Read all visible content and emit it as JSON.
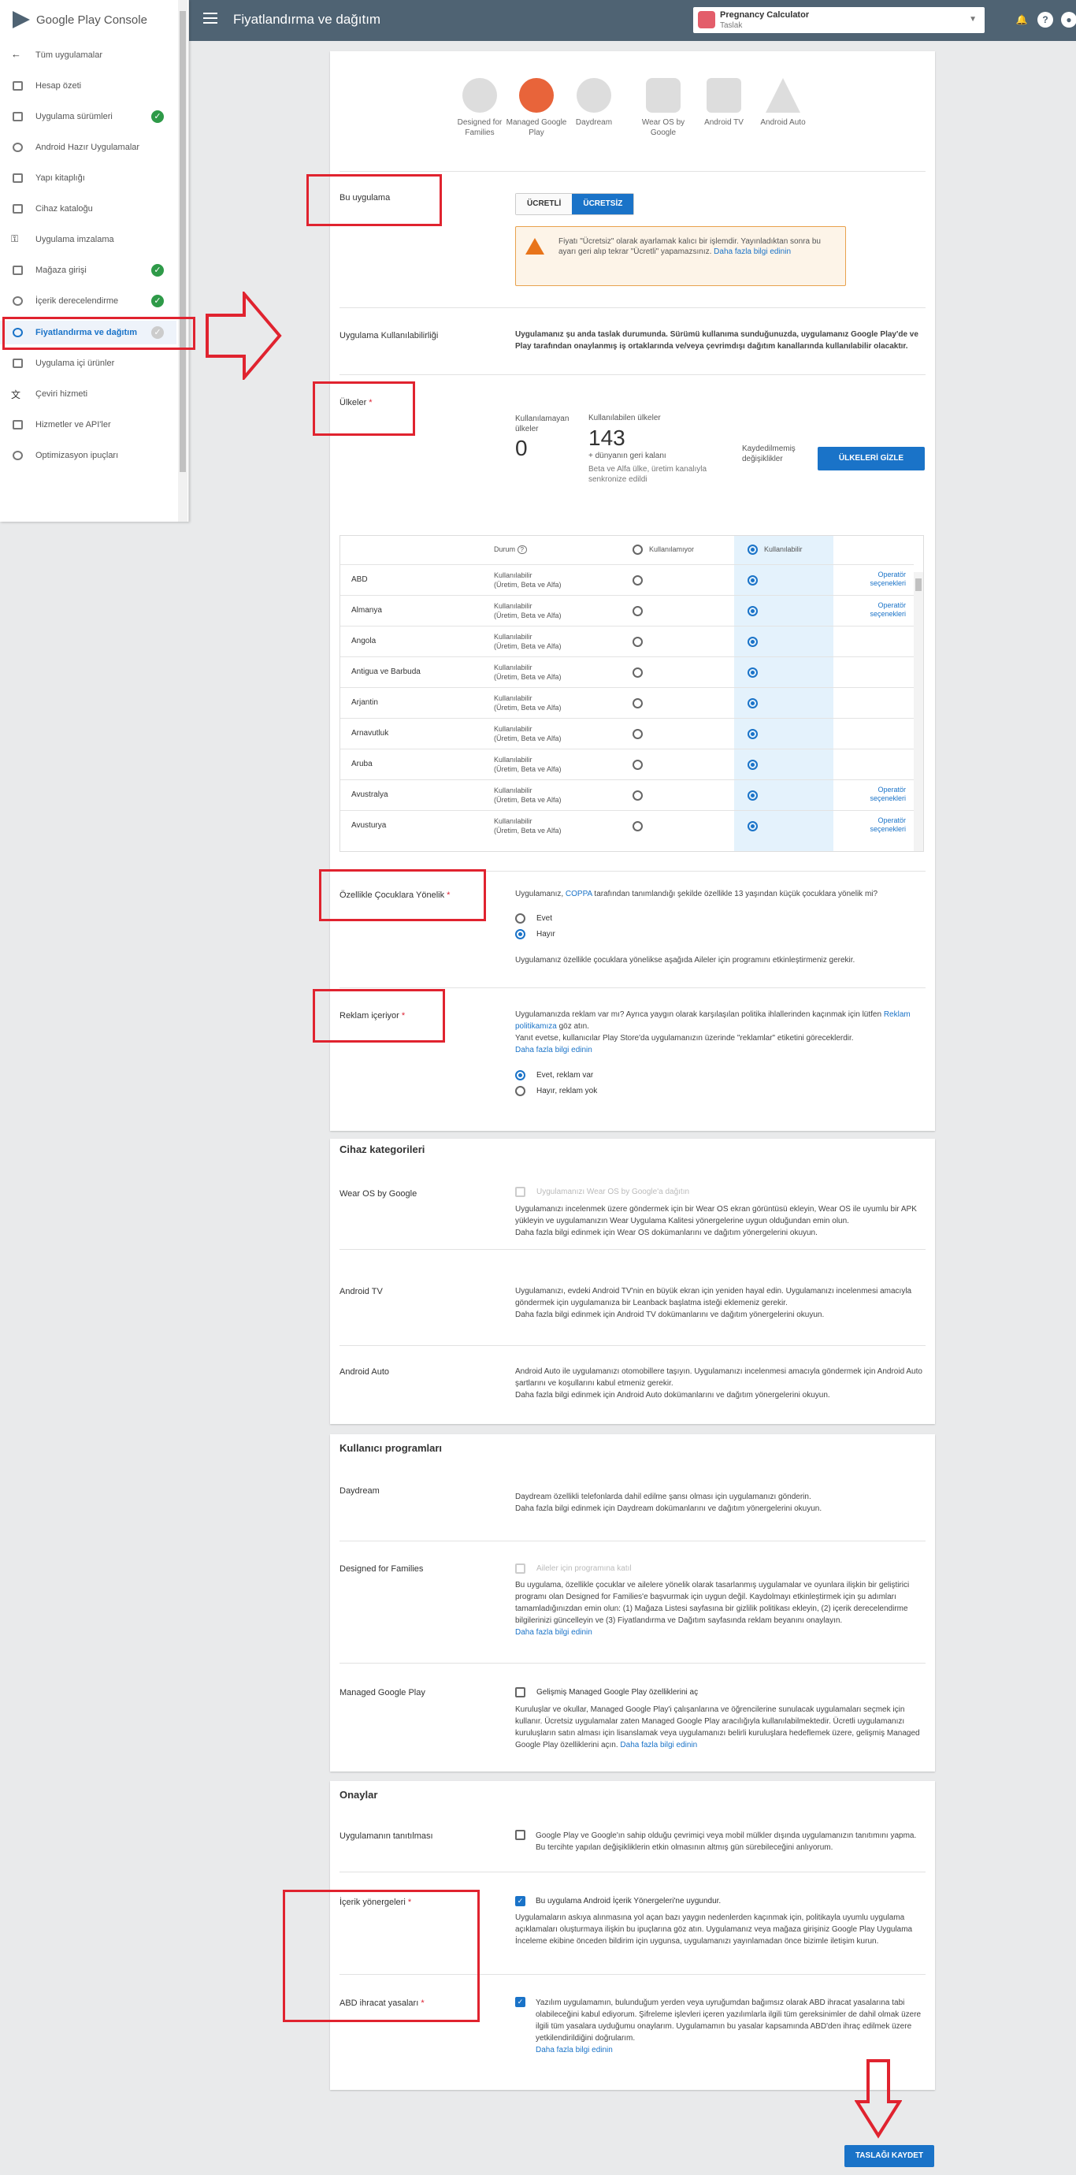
{
  "topbar": {
    "title": "Fiyatlandırma ve dağıtım",
    "app_name": "Pregnancy Calculator",
    "app_status": "Taslak"
  },
  "brand": {
    "logo_text": "Google Play Console"
  },
  "sidebar": {
    "items": [
      {
        "label": "Tüm uygulamalar",
        "check": ""
      },
      {
        "label": "Hesap özeti",
        "check": ""
      },
      {
        "label": "Uygulama sürümleri",
        "check": "✓"
      },
      {
        "label": "Android Hazır Uygulamalar",
        "check": ""
      },
      {
        "label": "Yapı kitaplığı",
        "check": ""
      },
      {
        "label": "Cihaz kataloğu",
        "check": ""
      },
      {
        "label": "Uygulama imzalama",
        "check": ""
      },
      {
        "label": "Mağaza girişi",
        "check": "✓"
      },
      {
        "label": "İçerik derecelendirme",
        "check": "✓"
      },
      {
        "label": "Fiyatlandırma ve dağıtım",
        "check": "✓"
      },
      {
        "label": "Uygulama içi ürünler",
        "check": ""
      },
      {
        "label": "Çeviri hizmeti",
        "check": ""
      },
      {
        "label": "Hizmetler ve API'ler",
        "check": ""
      },
      {
        "label": "Optimizasyon ipuçları",
        "check": ""
      }
    ]
  },
  "devices": [
    {
      "label": "Designed for Families"
    },
    {
      "label": "Managed Google Play"
    },
    {
      "label": "Daydream"
    },
    {
      "label": "Wear OS by Google"
    },
    {
      "label": "Android TV"
    },
    {
      "label": "Android Auto"
    }
  ],
  "pricing": {
    "label": "Bu uygulama",
    "paid": "ÜCRETLİ",
    "free": "ÜCRETSİZ",
    "warning": "Fiyatı \"Ücretsiz\" olarak ayarlamak kalıcı bir işlemdir. Yayınladıktan sonra bu ayarı geri alıp tekrar \"Ücretli\" yapamazsınız.",
    "warning_link": "Daha fazla bilgi edinin"
  },
  "availability": {
    "label": "Uygulama Kullanılabilirliği",
    "text": "Uygulamanız şu anda taslak durumunda. Sürümü kullanıma sunduğunuzda, uygulamanız Google Play'de ve Play tarafından onaylanmış iş ortaklarında ve/veya çevrimdışı dağıtım kanallarında kullanılabilir olacaktır."
  },
  "countries": {
    "label": "Ülkeler",
    "unavail_label": "Kullanılamayan ülkeler",
    "unavail_count": "0",
    "avail_label": "Kullanılabilen ülkeler",
    "avail_count": "143",
    "rest_world": "+ dünyanın geri kalanı",
    "beta_note": "Beta ve Alfa ülke, üretim kanalıyla senkronize edildi",
    "unsaved": "Kaydedilmemiş değişiklikler",
    "hide_btn": "ÜLKELERİ GİZLE",
    "col_status": "Durum",
    "col_unavail": "Kullanılamıyor",
    "col_avail": "Kullanılabilir",
    "rows": [
      {
        "name": "ABD",
        "status1": "Kullanılabilir",
        "status2": "(Üretim, Beta ve Alfa)",
        "opt1": "Operatör",
        "opt2": "seçenekleri"
      },
      {
        "name": "Almanya",
        "status1": "Kullanılabilir",
        "status2": "(Üretim, Beta ve Alfa)",
        "opt1": "Operatör",
        "opt2": "seçenekleri"
      },
      {
        "name": "Angola",
        "status1": "Kullanılabilir",
        "status2": "(Üretim, Beta ve Alfa)",
        "opt1": "",
        "opt2": ""
      },
      {
        "name": "Antigua ve Barbuda",
        "status1": "Kullanılabilir",
        "status2": "(Üretim, Beta ve Alfa)",
        "opt1": "",
        "opt2": ""
      },
      {
        "name": "Arjantin",
        "status1": "Kullanılabilir",
        "status2": "(Üretim, Beta ve Alfa)",
        "opt1": "",
        "opt2": ""
      },
      {
        "name": "Arnavutluk",
        "status1": "Kullanılabilir",
        "status2": "(Üretim, Beta ve Alfa)",
        "opt1": "",
        "opt2": ""
      },
      {
        "name": "Aruba",
        "status1": "Kullanılabilir",
        "status2": "(Üretim, Beta ve Alfa)",
        "opt1": "",
        "opt2": ""
      },
      {
        "name": "Avustralya",
        "status1": "Kullanılabilir",
        "status2": "(Üretim, Beta ve Alfa)",
        "opt1": "Operatör",
        "opt2": "seçenekleri"
      },
      {
        "name": "Avusturya",
        "status1": "Kullanılabilir",
        "status2": "(Üretim, Beta ve Alfa)",
        "opt1": "Operatör",
        "opt2": "seçenekleri"
      }
    ]
  },
  "children": {
    "label": "Özellikle Çocuklara Yönelik",
    "q_pre": "Uygulamanız,",
    "q_link": "COPPA",
    "q_post": "tarafından tanımlandığı şekilde özellikle 13 yaşından küçük çocuklara yönelik mi?",
    "yes": "Evet",
    "no": "Hayır",
    "note": "Uygulamanız özellikle çocuklara yönelikse aşağıda Aileler için programını etkinleştirmeniz gerekir."
  },
  "ads": {
    "label": "Reklam içeriyor",
    "text1": "Uygulamanızda reklam var mı? Ayrıca yaygın olarak karşılaşılan politika ihlallerinden kaçınmak için lütfen",
    "link1": "Reklam politikamıza",
    "text1b": "göz atın.",
    "text2": "Yanıt evetse, kullanıcılar Play Store'da uygulamanızın üzerinde \"reklamlar\" etiketini göreceklerdir.",
    "link2": "Daha fazla bilgi edinin",
    "yes": "Evet, reklam var",
    "no": "Hayır, reklam yok"
  },
  "device_cats": {
    "title": "Cihaz kategorileri",
    "wear_label": "Wear OS by Google",
    "wear_cb": "Uygulamanızı Wear OS by Google'a dağıtın",
    "wear_text": "Uygulamanızı incelenmek üzere göndermek için bir Wear OS ekran görüntüsü ekleyin, Wear OS ile uyumlu bir APK yükleyin ve uygulamanızın Wear Uygulama Kalitesi yönergelerine uygun olduğundan emin olun.",
    "wear_text2": "Daha fazla bilgi edinmek için Wear OS dokümanlarını ve dağıtım yönergelerini okuyun.",
    "tv_label": "Android TV",
    "tv_text": "Uygulamanızı, evdeki Android TV'nin en büyük ekran için yeniden hayal edin. Uygulamanızı incelenmesi amacıyla göndermek için uygulamanıza bir Leanback başlatma isteği eklemeniz gerekir.",
    "tv_text2": "Daha fazla bilgi edinmek için Android TV dokümanlarını ve dağıtım yönergelerini okuyun.",
    "auto_label": "Android Auto",
    "auto_text": "Android Auto ile uygulamanızı otomobillere taşıyın. Uygulamanızı incelenmesi amacıyla göndermek için Android Auto şartlarını ve koşullarını kabul etmeniz gerekir.",
    "auto_text2": "Daha fazla bilgi edinmek için Android Auto dokümanlarını ve dağıtım yönergelerini okuyun."
  },
  "user_programs": {
    "title": "Kullanıcı programları",
    "daydream_label": "Daydream",
    "daydream_text": "Daydream özellikli telefonlarda dahil edilme şansı olması için uygulamanızı gönderin.",
    "daydream_text2": "Daha fazla bilgi edinmek için Daydream dokümanlarını ve dağıtım yönergelerini okuyun.",
    "families_label": "Designed for Families",
    "families_cb": "Aileler için programına katıl",
    "families_text": "Bu uygulama, özellikle çocuklar ve ailelere yönelik olarak tasarlanmış uygulamalar ve oyunlara ilişkin bir geliştirici programı olan Designed for Families'e başvurmak için uygun değil. Kaydolmayı etkinleştirmek için şu adımları tamamladığınızdan emin olun: (1) Mağaza Listesi sayfasına bir gizlilik politikası ekleyin, (2) içerik derecelendirme bilgilerinizi güncelleyin ve (3) Fiyatlandırma ve Dağıtım sayfasında reklam beyanını onaylayın.",
    "families_link": "Daha fazla bilgi edinin",
    "managed_label": "Managed Google Play",
    "managed_cb": "Gelişmiş Managed Google Play özelliklerini aç",
    "managed_text": "Kuruluşlar ve okullar, Managed Google Play'i çalışanlarına ve öğrencilerine sunulacak uygulamaları seçmek için kullanır. Ücretsiz uygulamalar zaten Managed Google Play aracılığıyla kullanılabilmektedir. Ücretli uygulamanızı kuruluşların satın alması için lisanslamak veya uygulamanızı belirli kuruluşlara hedeflemek üzere, gelişmiş Managed Google Play özelliklerini açın.",
    "managed_link": "Daha fazla bilgi edinin"
  },
  "consent": {
    "title": "Onaylar",
    "promo_label": "Uygulamanın tanıtılması",
    "promo_text": "Google Play ve Google'ın sahip olduğu çevrimiçi veya mobil mülkler dışında uygulamanızın tanıtımını yapma. Bu tercihte yapılan değişikliklerin etkin olmasının altmış gün sürebileceğini anlıyorum.",
    "content_label": "İçerik yönergeleri",
    "content_cb": "Bu uygulama Android İçerik Yönergeleri'ne uygundur.",
    "content_text": "Uygulamaların askıya alınmasına yol açan bazı yaygın nedenlerden kaçınmak için, politikayla uyumlu uygulama açıklamaları oluşturmaya ilişkin bu ipuçlarına göz atın. Uygulamanız veya mağaza girişiniz Google Play Uygulama İnceleme ekibine önceden bildirim için uygunsa, uygulamanızı yayınlamadan önce bizimle iletişim kurun.",
    "export_label": "ABD ihracat yasaları",
    "export_text": "Yazılım uygulamamın, bulunduğum yerden veya uyruğumdan bağımsız olarak ABD ihracat yasalarına tabi olabileceğini kabul ediyorum. Şifreleme işlevleri içeren yazılımlarla ilgili tüm gereksinimler de dahil olmak üzere ilgili tüm yasalara uyduğumu onaylarım. Uygulamamın bu yasalar kapsamında ABD'den ihraç edilmek üzere yetkilendirildiğini doğrularım.",
    "export_link": "Daha fazla bilgi edinin"
  },
  "footer": {
    "save_draft": "TASLAĞI KAYDET"
  },
  "colors": {
    "topbar": "#4f6373",
    "accent": "#1a73c8",
    "annotation": "#e0232f",
    "ok": "#2e9a48"
  }
}
